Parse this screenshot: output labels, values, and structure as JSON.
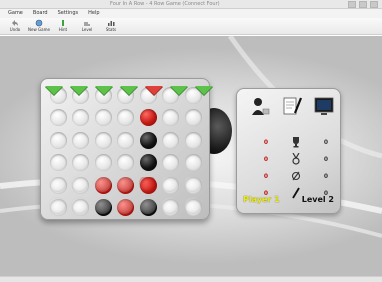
{
  "window": {
    "title": "Four In A Row - 4 Row Game (Connect Four)"
  },
  "menu": {
    "items": [
      "Game",
      "Board",
      "Settings",
      "Help"
    ]
  },
  "toolbar": {
    "buttons": [
      {
        "label": "Undo",
        "icon": "undo-icon"
      },
      {
        "label": "New Game",
        "icon": "new-game-icon"
      },
      {
        "label": "Hint",
        "icon": "hint-icon"
      },
      {
        "label": "Level",
        "icon": "level-icon"
      },
      {
        "label": "Stats",
        "icon": "stats-icon"
      }
    ]
  },
  "colors": {
    "drop_arrow": "#5cc24a",
    "selected_arrow": "#e0403a",
    "player_text": "#e8e81a",
    "red_piece": "#c51a14",
    "black_piece": "#141414"
  },
  "game": {
    "selected_column": 4,
    "rows": [
      [
        "",
        "",
        "",
        "",
        "",
        "",
        ""
      ],
      [
        "",
        "",
        "",
        "",
        "R",
        "",
        ""
      ],
      [
        "",
        "",
        "",
        "",
        "B",
        "",
        ""
      ],
      [
        "",
        "",
        "",
        "",
        "B",
        "",
        ""
      ],
      [
        "",
        "",
        "R",
        "R",
        "R",
        "",
        ""
      ],
      [
        "",
        "",
        "B",
        "R",
        "B",
        "",
        ""
      ]
    ]
  },
  "panel": {
    "top_icons": [
      "player-vs-icon",
      "notepad-icon",
      "computer-monitor-icon"
    ],
    "stats_rows": [
      {
        "left": "0",
        "icon": "trophy-icon",
        "right": "0"
      },
      {
        "left": "0",
        "icon": "medal-icon",
        "right": "0"
      },
      {
        "left": "0",
        "icon": "draw-icon",
        "right": "0"
      },
      {
        "left": "0",
        "icon": "pencil-icon",
        "right": "0"
      }
    ],
    "player_label": "Player 1",
    "level_label": "Level 2"
  }
}
